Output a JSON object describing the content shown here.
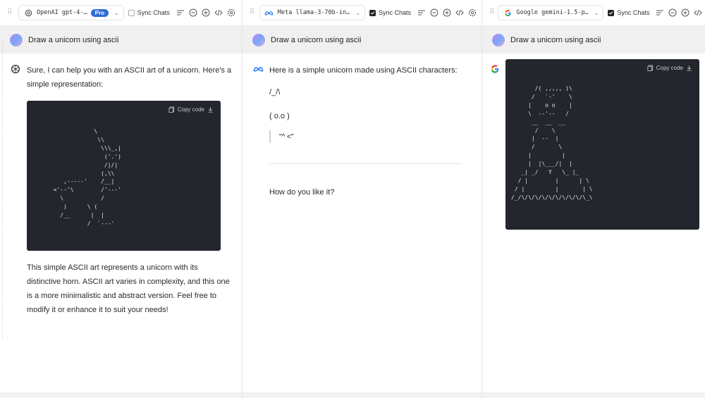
{
  "panes": [
    {
      "model_name": "OpenAI gpt-4-…",
      "badge": "Pro",
      "sync_label": "Sync Chats",
      "sync_checked": false,
      "user_prompt": "Draw a unicorn using ascii",
      "intro": "Sure, I can help you with an ASCII art of a unicorn. Here's a simple representation:",
      "copy_label": "Copy code",
      "ascii": "              \\\n               \\\\\n                \\\\\\_,|\n                 ('.')\n                 /|/|\n                (,\\\\\n     ,-----'    /__|\n  <'--'\\        /'---'\n    \\           /\n     )      \\ (\n    /__      |  |\n            /  `---'",
      "outro": "This simple ASCII art represents a unicorn with its distinctive horn. ASCII art varies in complexity, and this one is a more minimalistic and abstract version. Feel free to modify it or enhance it to suit your needs!"
    },
    {
      "model_name": "Meta llama-3-70b-in…",
      "sync_label": "Sync Chats",
      "sync_checked": true,
      "user_prompt": "Draw a unicorn using ascii",
      "intro": "Here is a simple unicorn made using ASCII characters:",
      "line1": "/_/\\",
      "line2": "( o.o )",
      "quote": "\"^ <\"",
      "closing": "How do you like it?"
    },
    {
      "model_name": "Google gemini-1.5-p…",
      "sync_label": "Sync Chats",
      "sync_checked": true,
      "user_prompt": "Draw a unicorn using ascii",
      "copy_label": "Copy code",
      "ascii": "       /( ,,,,, )\\\n      /   `-'    \\\n     |    o o    |\n     \\  --'--   /\n      __  __  __\n       /    \\\n      |  --  |\n      /       \\\n     |         |\n     |  |\\___/|  |\n   _| _/   Y   \\_ |_\n  / |        |      | \\\n / |         |       | \\\n/_/\\/\\/\\/\\/\\/\\/\\/\\/\\/\\_\\"
    }
  ]
}
